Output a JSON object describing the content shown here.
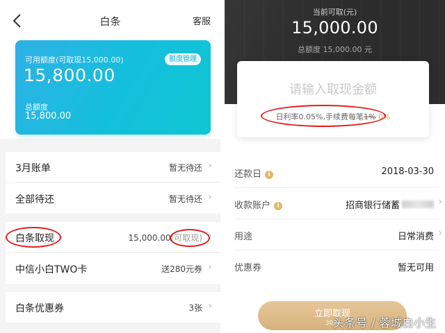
{
  "left": {
    "header": {
      "title": "白条",
      "service": "客服"
    },
    "card": {
      "available_label": "可用额度(可取现15,000.00)",
      "available_value": "15,800.00",
      "manage_button": "额度管理",
      "total_label": "总额度",
      "total_value": "15,800.00"
    },
    "rows": [
      {
        "label": "3月账单",
        "value": "暂无待还"
      },
      {
        "label": "全部待还",
        "value": "暂无待还"
      },
      {
        "label": "白条取现",
        "value": "15,000.00",
        "hint": "(可取现)"
      },
      {
        "label": "中信小白TWO卡",
        "value": "送280元券"
      },
      {
        "label": "白条优惠券",
        "value": "3张"
      }
    ]
  },
  "right": {
    "header": {
      "current_label": "当前可取(元)",
      "current_value": "15,000.00",
      "total_text": "总额度 15,000.00 元"
    },
    "input": {
      "placeholder": "请输入取现金额",
      "rate_text": "日利率0.05%,手续费每笔",
      "fee_old": "1%",
      "fee_new": "0%"
    },
    "form": [
      {
        "label": "还款日",
        "value": "2018-03-30"
      },
      {
        "label": "收款账户",
        "value": "招商银行储蓄"
      },
      {
        "label": "用途",
        "value": "日常消费"
      },
      {
        "label": "优惠券",
        "value": "暂无可用"
      }
    ],
    "submit": {
      "label": "立即取现",
      "sub": "30天"
    }
  },
  "watermark": "头条号 / 蓉城白小生",
  "colors": {
    "accent_teal": "#14bfdc",
    "gold": "#d7a96b",
    "annotation_red": "#e21b1b"
  },
  "icons": [
    "chevron-left-icon",
    "chevron-right-icon",
    "info-icon"
  ]
}
